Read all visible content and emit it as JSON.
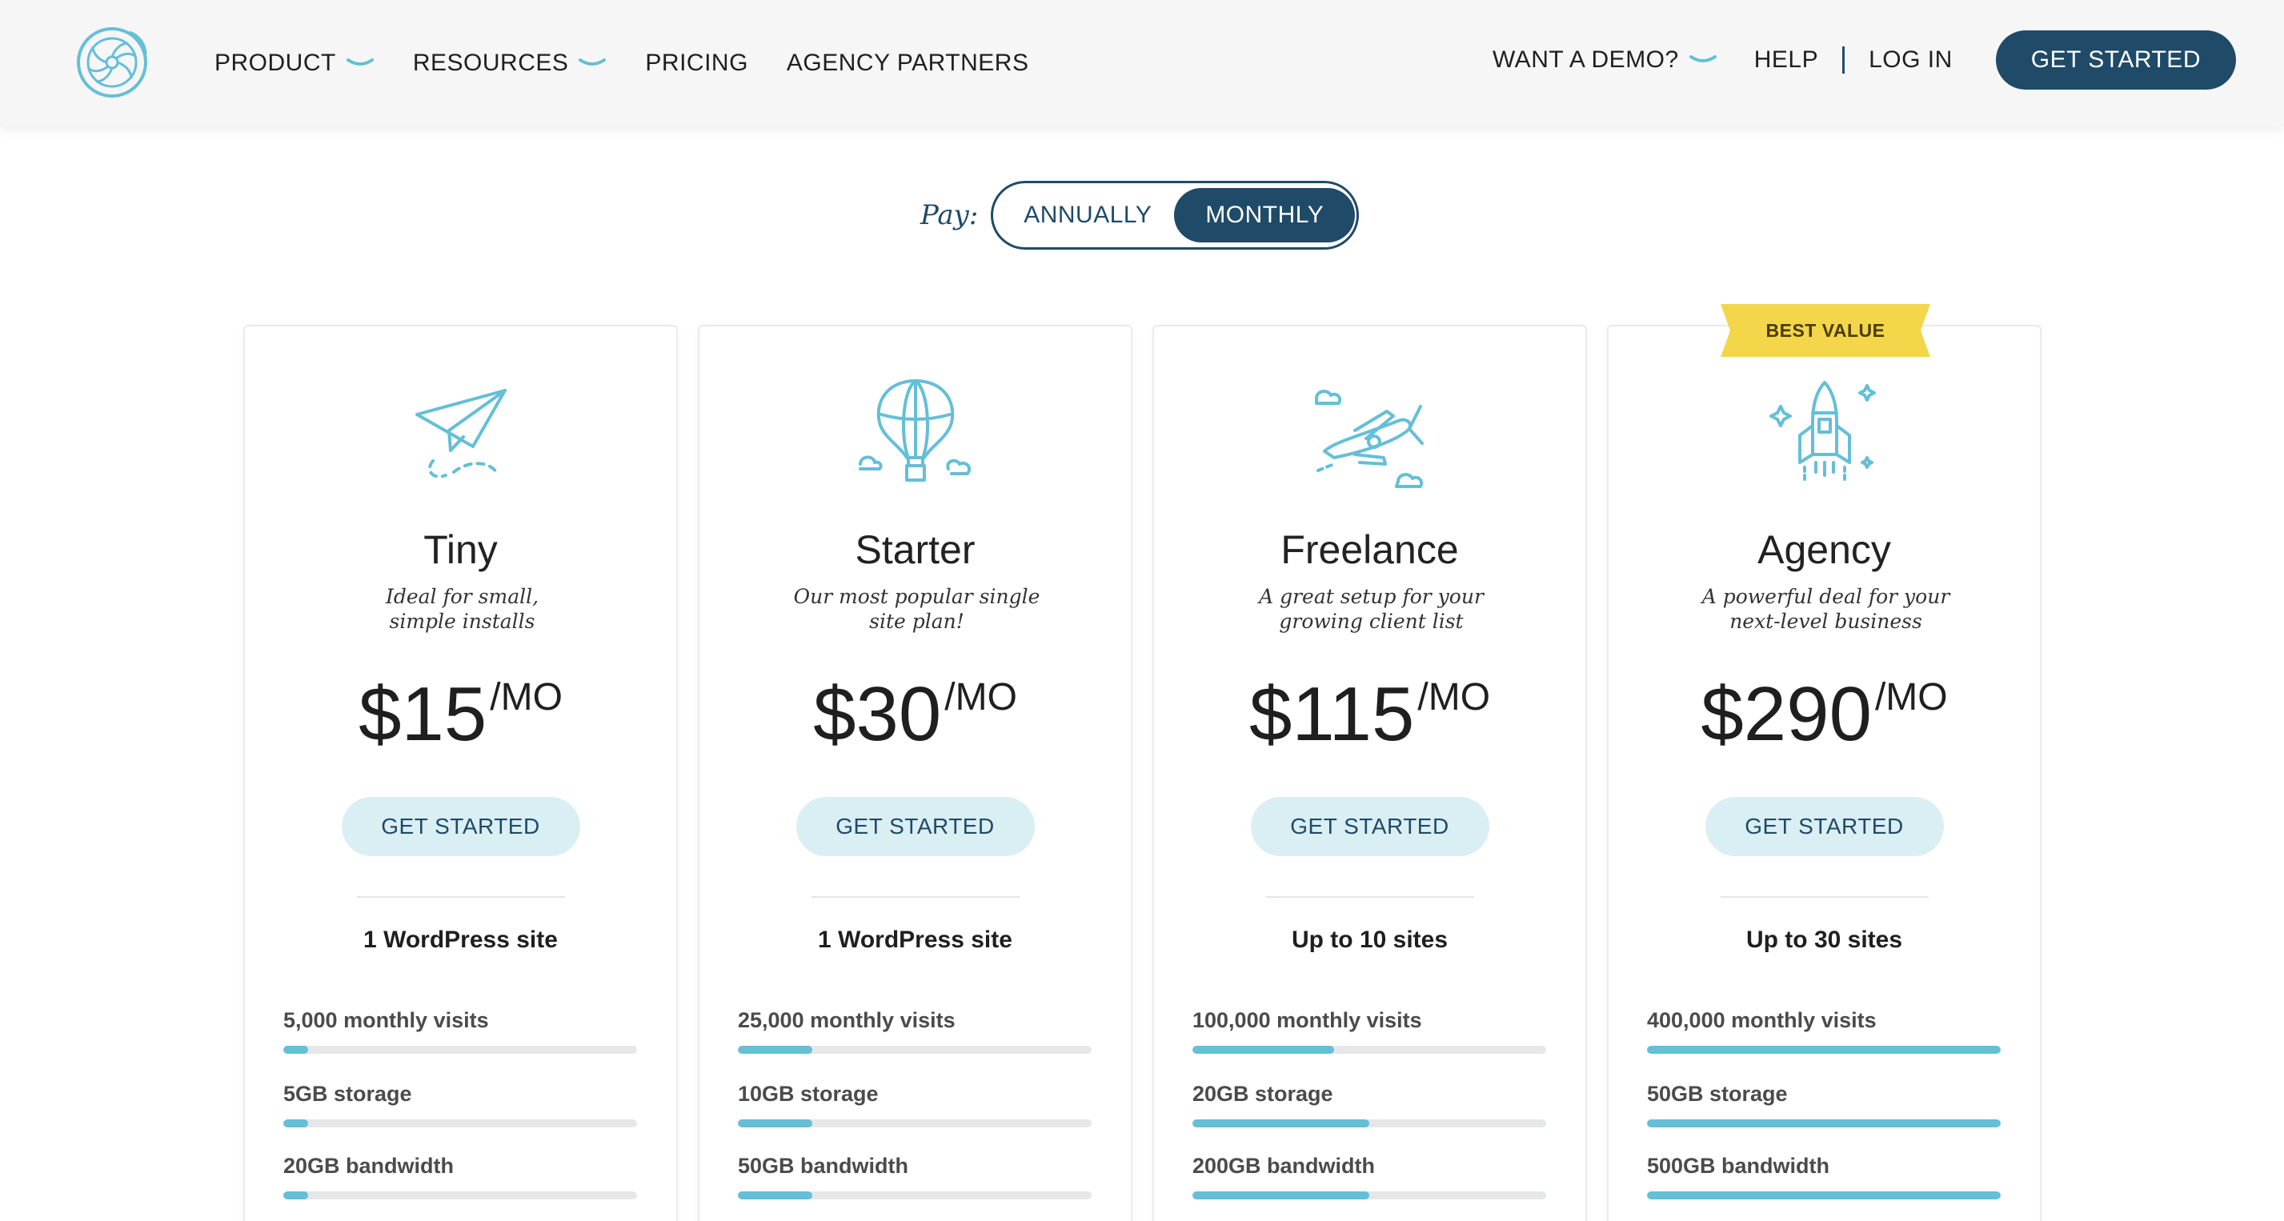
{
  "header": {
    "nav": [
      {
        "label": "PRODUCT",
        "dropdown": true
      },
      {
        "label": "RESOURCES",
        "dropdown": true
      },
      {
        "label": "PRICING",
        "dropdown": false
      },
      {
        "label": "AGENCY PARTNERS",
        "dropdown": false
      }
    ],
    "demo_label": "WANT A DEMO?",
    "help_label": "HELP",
    "login_label": "LOG IN",
    "cta_label": "GET STARTED"
  },
  "billing": {
    "label": "Pay:",
    "options": [
      "ANNUALLY",
      "MONTHLY"
    ],
    "selected": "MONTHLY"
  },
  "badge": "BEST VALUE",
  "plans": [
    {
      "name": "Tiny",
      "icon": "paper-plane-icon",
      "desc_line1": "Ideal for small,",
      "desc_line2": "simple installs",
      "price": "$15",
      "unit": "/MO",
      "cta": "GET STARTED",
      "sites": "1 WordPress site",
      "visits": "5,000 monthly visits",
      "visits_fraction": 0.07,
      "storage": "5GB storage",
      "storage_fraction": 0.07,
      "bandwidth": "20GB bandwidth",
      "bandwidth_fraction": 0.07
    },
    {
      "name": "Starter",
      "icon": "hot-air-balloon-icon",
      "desc_line1": "Our most popular single",
      "desc_line2": "site plan!",
      "price": "$30",
      "unit": "/MO",
      "cta": "GET STARTED",
      "sites": "1 WordPress site",
      "visits": "25,000 monthly visits",
      "visits_fraction": 0.21,
      "storage": "10GB storage",
      "storage_fraction": 0.21,
      "bandwidth": "50GB bandwidth",
      "bandwidth_fraction": 0.21
    },
    {
      "name": "Freelance",
      "icon": "biplane-icon",
      "desc_line1": "A great setup for your",
      "desc_line2": "growing client list",
      "price": "$115",
      "unit": "/MO",
      "cta": "GET STARTED",
      "sites": "Up to 10 sites",
      "visits": "100,000 monthly visits",
      "visits_fraction": 0.4,
      "storage": "20GB storage",
      "storage_fraction": 0.5,
      "bandwidth": "200GB bandwidth",
      "bandwidth_fraction": 0.5
    },
    {
      "name": "Agency",
      "icon": "rocket-icon",
      "desc_line1": "A powerful deal for your",
      "desc_line2": "next-level business",
      "price": "$290",
      "unit": "/MO",
      "cta": "GET STARTED",
      "sites": "Up to 30 sites",
      "visits": "400,000 monthly visits",
      "visits_fraction": 1.0,
      "storage": "50GB storage",
      "storage_fraction": 1.0,
      "bandwidth": "500GB bandwidth",
      "bandwidth_fraction": 1.0
    }
  ],
  "colors": {
    "brand_dark": "#1f4a68",
    "accent": "#64bfd7",
    "button_light": "#daeff3",
    "badge": "#f3d64a"
  }
}
